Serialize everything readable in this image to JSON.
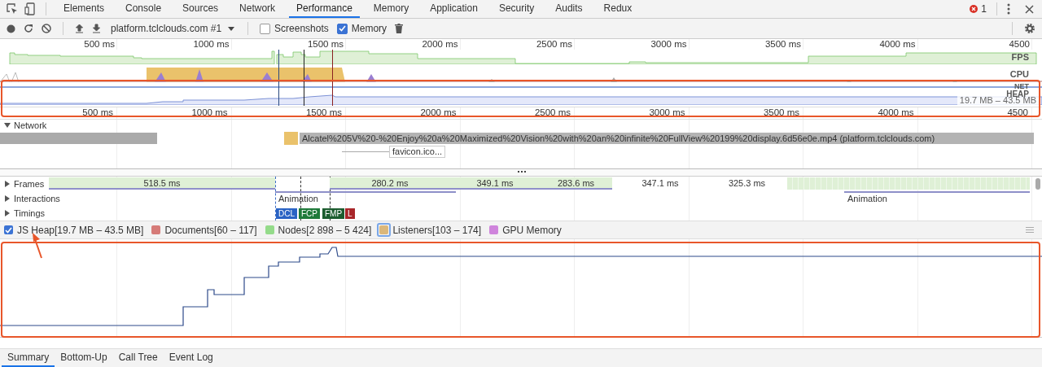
{
  "tabs": [
    {
      "label": "Elements",
      "selected": false
    },
    {
      "label": "Console",
      "selected": false
    },
    {
      "label": "Sources",
      "selected": false
    },
    {
      "label": "Network",
      "selected": false
    },
    {
      "label": "Performance",
      "selected": true
    },
    {
      "label": "Memory",
      "selected": false
    },
    {
      "label": "Application",
      "selected": false
    },
    {
      "label": "Security",
      "selected": false
    },
    {
      "label": "Audits",
      "selected": false
    },
    {
      "label": "Redux",
      "selected": false
    }
  ],
  "error_count": "1",
  "toolbar": {
    "target": "platform.tclclouds.com #1",
    "options": [
      {
        "label": "Screenshots",
        "checked": false
      },
      {
        "label": "Memory",
        "checked": true
      }
    ]
  },
  "overview": {
    "ticks": [
      "500 ms",
      "1000 ms",
      "1500 ms",
      "2000 ms",
      "2500 ms",
      "3000 ms",
      "3500 ms",
      "4000 ms",
      "4500"
    ],
    "track_labels": [
      "FPS",
      "CPU",
      "NET",
      "HEAP"
    ],
    "heap_range": "19.7 MB – 43.5 MB",
    "bottom_ticks": [
      "500 ms",
      "1000 ms",
      "1500 ms",
      "2000 ms",
      "2500 ms",
      "3000 ms",
      "3500 ms",
      "4000 ms",
      "4500"
    ]
  },
  "network": {
    "label": "Network",
    "expanded": true,
    "requests": [
      {
        "label": "Alcatel%205V%20-%20Enjoy%20a%20Maximized%20Vision%20with%20an%20infinite%20FullView%20199%20display.6d56e0e.mp4 (platform.tclclouds.com)"
      },
      {
        "label": "favicon.ico..."
      }
    ]
  },
  "tracks": [
    {
      "label": "Frames",
      "expanded": false,
      "kind": "frames",
      "items": [
        "518.5 ms",
        "280.2 ms",
        "349.1 ms",
        "283.6 ms",
        "347.1 ms",
        "325.3 ms"
      ]
    },
    {
      "label": "Interactions",
      "expanded": false,
      "kind": "interactions",
      "items": [
        "Animation",
        "Animation"
      ]
    },
    {
      "label": "Timings",
      "expanded": false,
      "kind": "timings",
      "items": [
        "DCL",
        "FCP",
        "FMP",
        "L"
      ]
    }
  ],
  "counters": [
    {
      "label": "JS Heap[19.7 MB – 43.5 MB]",
      "checked": true,
      "focused": false,
      "color": "#3b73d4"
    },
    {
      "label": "Documents[60 – 117]",
      "checked": false,
      "focused": false,
      "color": "#d67b78"
    },
    {
      "label": "Nodes[2 898 – 5 424]",
      "checked": false,
      "focused": false,
      "color": "#94db8a"
    },
    {
      "label": "Listeners[103 – 174]",
      "checked": false,
      "focused": true,
      "color": "#dbb77a"
    },
    {
      "label": "GPU Memory",
      "checked": false,
      "focused": false,
      "color": "#cf84dc"
    }
  ],
  "bottom_tabs": [
    {
      "label": "Summary",
      "selected": true
    },
    {
      "label": "Bottom-Up",
      "selected": false
    },
    {
      "label": "Call Tree",
      "selected": false
    },
    {
      "label": "Event Log",
      "selected": false
    }
  ]
}
